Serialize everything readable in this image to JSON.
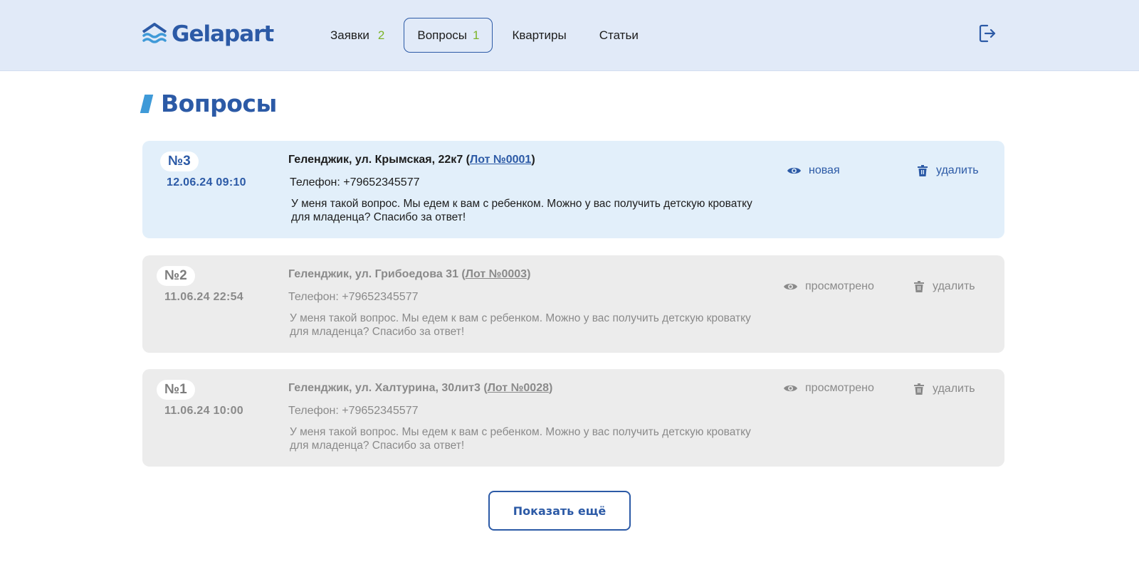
{
  "header": {
    "logo_text": "Gelapart",
    "nav": [
      {
        "label": "Заявки",
        "count": "2"
      },
      {
        "label": "Вопросы",
        "count": "1"
      },
      {
        "label": "Квартиры"
      },
      {
        "label": "Статьи"
      }
    ],
    "active_tab": "Вопросы",
    "logout_icon": "logout-icon"
  },
  "page": {
    "title": "Вопросы"
  },
  "questions": [
    {
      "number": "№3",
      "date": "12.06.24 09:10",
      "address": "Геленджик, ул. Крымская, 22к7",
      "lot": "Лот №0001",
      "phone": "Телефон: +79652345577",
      "message": "У меня такой вопрос. Мы едем к вам с ребенком. Можно у вас получить детскую кроватку для младенца? Спасибо за ответ!",
      "status": "новая",
      "delete_label": "удалить"
    },
    {
      "number": "№2",
      "date": "11.06.24 22:54",
      "address": "Геленджик, ул. Грибоедова 31",
      "lot": "Лот №0003",
      "phone": "Телефон: +79652345577",
      "message": "У меня такой вопрос. Мы едем к вам с ребенком. Можно у вас получить детскую кроватку для младенца? Спасибо за ответ!",
      "status": "просмотрено",
      "delete_label": "удалить"
    },
    {
      "number": "№1",
      "date": "11.06.24 10:00",
      "address": "Геленджик, ул. Халтурина, 30лит3",
      "lot": "Лот №0028",
      "phone": "Телефон: +79652345577",
      "message": "У меня такой вопрос. Мы едем к вам с ребенком. Можно у вас получить детскую кроватку для младенца? Спасибо за ответ!",
      "status": "просмотрено",
      "delete_label": "удалить"
    }
  ],
  "show_more_label": "Показать ещё",
  "colors": {
    "header_bg": "#e1eaf8",
    "brand_blue": "#2c5aa6",
    "accent_light_blue": "#3f9ad8",
    "count_green": "#7bb327",
    "new_card_bg": "#e2effa",
    "seen_card_bg": "#ececec",
    "muted_text": "#8a8a8a"
  }
}
